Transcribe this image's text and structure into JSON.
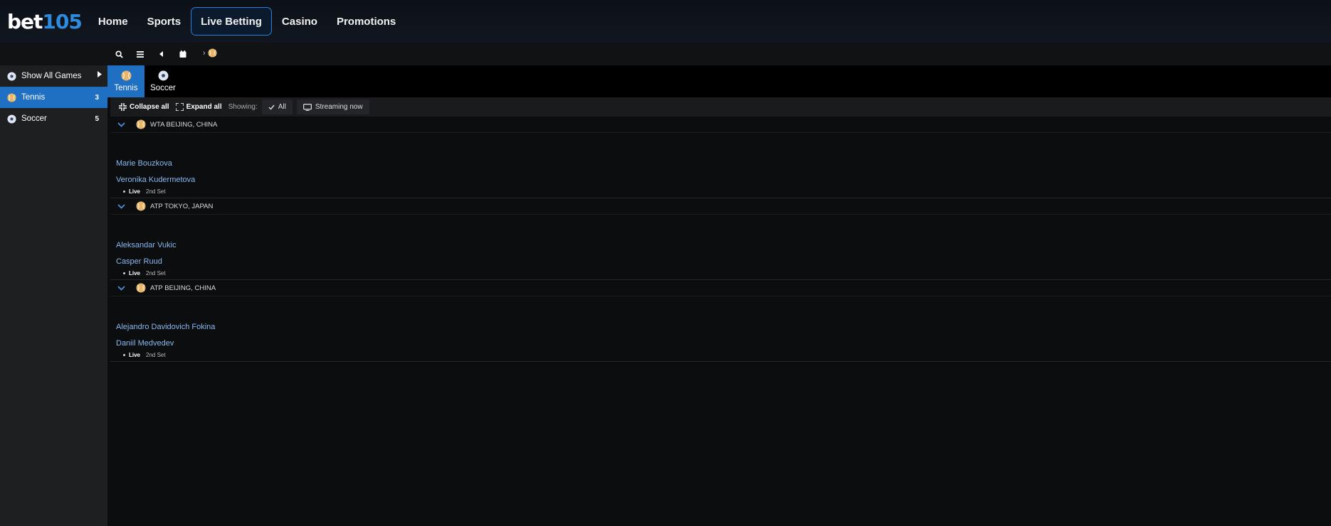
{
  "header": {
    "logo_part1": "bet",
    "logo_part2": "105",
    "nav": [
      "Home",
      "Sports",
      "Live Betting",
      "Casino",
      "Promotions"
    ],
    "active_nav": "Live Betting"
  },
  "toolbar": {
    "breadcrumb_separator": "›",
    "icons": [
      "search-icon",
      "list-icon",
      "back-icon",
      "calendar-icon",
      "tennis-ball-icon"
    ]
  },
  "sidebar": {
    "items": [
      {
        "label": "Show All Games",
        "icon": "soccer-ball-icon",
        "count": ""
      },
      {
        "label": "Tennis",
        "icon": "tennis-ball-icon",
        "count": "3"
      },
      {
        "label": "Soccer",
        "icon": "soccer-ball-icon",
        "count": "5"
      }
    ]
  },
  "sport_tabs": [
    "Tennis",
    "Soccer"
  ],
  "filter_bar": {
    "collapse_label": "Collapse all",
    "expand_label": "Expand all",
    "showing_label": "Showing:",
    "all_label": "All",
    "streaming_label": "Streaming now"
  },
  "leagues": [
    {
      "name": "WTA BEIJING, CHINA",
      "team1": "Marie Bouzkova",
      "team2": "Veronika Kudermetova",
      "status": "Live",
      "period": "2nd Set"
    },
    {
      "name": "ATP TOKYO, JAPAN",
      "team1": "Aleksandar Vukic",
      "team2": "Casper Ruud",
      "status": "Live",
      "period": "2nd Set"
    },
    {
      "name": "ATP BEIJING, CHINA",
      "team1": "Alejandro Davidovich Fokina",
      "team2": "Daniil Medvedev",
      "status": "Live",
      "period": "2nd Set"
    }
  ],
  "colors": {
    "accent": "#1f6fc2",
    "logo_blue": "#2e8cdf",
    "team_link": "#8ab8f0"
  }
}
